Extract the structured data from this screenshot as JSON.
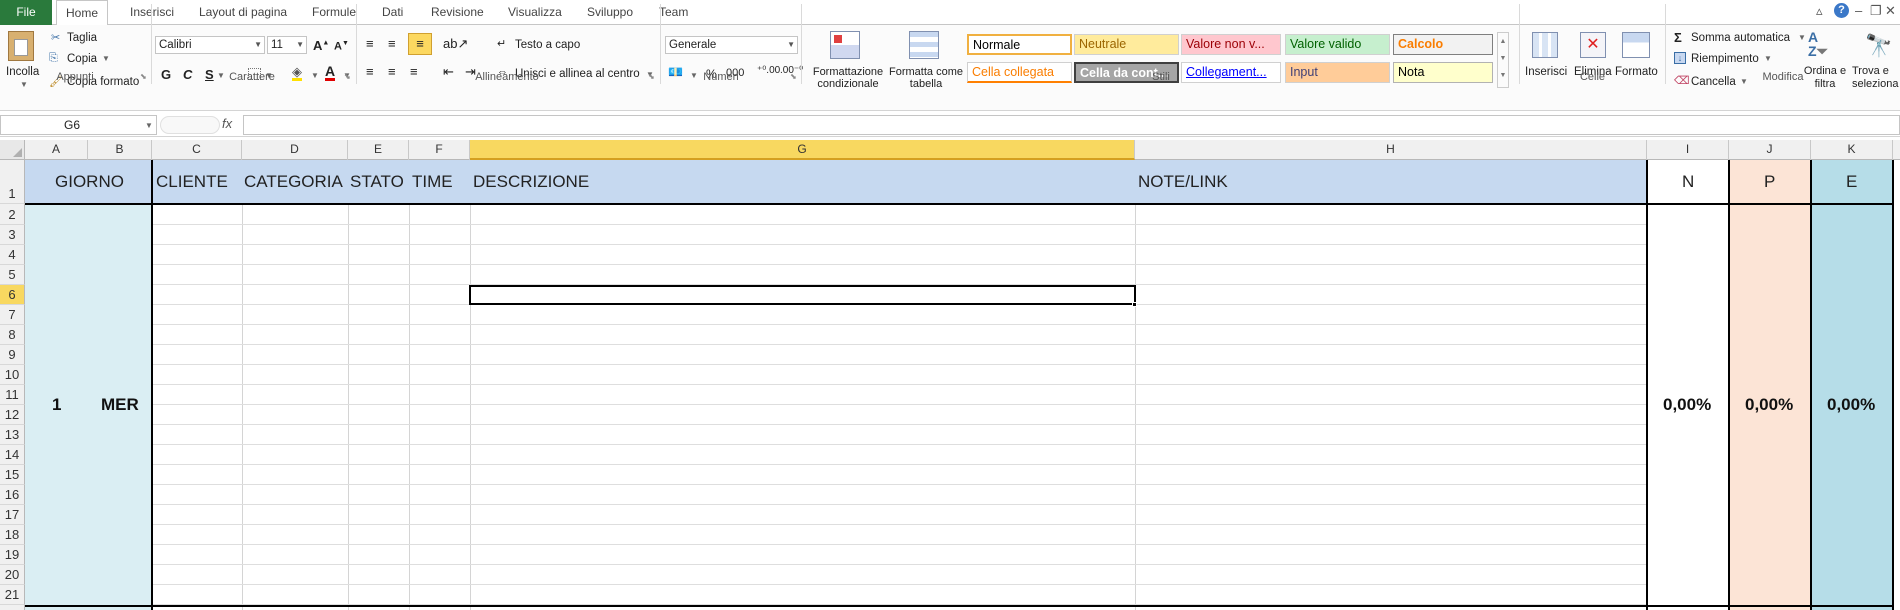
{
  "tabs": {
    "file": "File",
    "items": [
      "Home",
      "Inserisci",
      "Layout di pagina",
      "Formule",
      "Dati",
      "Revisione",
      "Visualizza",
      "Sviluppo",
      "Team"
    ]
  },
  "ribbon": {
    "clipboard": {
      "paste": "Incolla",
      "cut": "Taglia",
      "copy": "Copia",
      "format_painter": "Copia formato",
      "label": "Appunti"
    },
    "font": {
      "name": "Calibri",
      "size": "11",
      "bold": "G",
      "italic": "C",
      "underline": "S",
      "label": "Carattere"
    },
    "alignment": {
      "wrap": "Testo a capo",
      "merge": "Unisci e allinea al centro",
      "label": "Allineamento"
    },
    "number": {
      "format": "Generale",
      "percent": "%",
      "thousands": "000",
      "label": "Numeri"
    },
    "styles": {
      "conditional": "Formattazione condizionale",
      "table": "Formatta come tabella",
      "cells": [
        "Normale",
        "Neutrale",
        "Valore non v...",
        "Valore valido",
        "Calcolo",
        "Cella collegata",
        "Cella da cont...",
        "Collegament...",
        "Input",
        "Nota"
      ],
      "label": "Stili"
    },
    "cells": {
      "insert": "Inserisci",
      "delete": "Elimina",
      "format": "Formato",
      "label": "Celle"
    },
    "editing": {
      "autosum": "Somma automatica",
      "fill": "Riempimento",
      "clear": "Cancella",
      "sort": "Ordina e filtra",
      "find": "Trova e seleziona",
      "label": "Modifica"
    }
  },
  "formula_bar": {
    "name_box": "G6",
    "fx": "fx",
    "value": ""
  },
  "columns": [
    "A",
    "B",
    "C",
    "D",
    "E",
    "F",
    "G",
    "H",
    "I",
    "J",
    "K"
  ],
  "rows": [
    "1",
    "2",
    "3",
    "4",
    "5",
    "6",
    "7",
    "8",
    "9",
    "10",
    "11",
    "12",
    "13",
    "14",
    "15",
    "16",
    "17",
    "18",
    "19",
    "20",
    "21"
  ],
  "header_row": {
    "giorno": "GIORNO",
    "cliente": "CLIENTE",
    "categoria": "CATEGORIA",
    "stato": "STATO",
    "time": "TIME",
    "descrizione": "DESCRIZIONE",
    "note": "NOTE/LINK",
    "n": "N",
    "p": "P",
    "e": "E"
  },
  "day_block": {
    "number": "1",
    "day": "MER",
    "n_value": "0,00%",
    "p_value": "0,00%",
    "e_value": "0,00%"
  },
  "colors": {
    "header_blue": "#c6d9f0",
    "day_cyan": "#daeef3",
    "p_peach": "#fce4d6",
    "e_teal": "#b6dde8",
    "selected_col": "#f8d860",
    "excel_green": "#2a7a3c"
  }
}
